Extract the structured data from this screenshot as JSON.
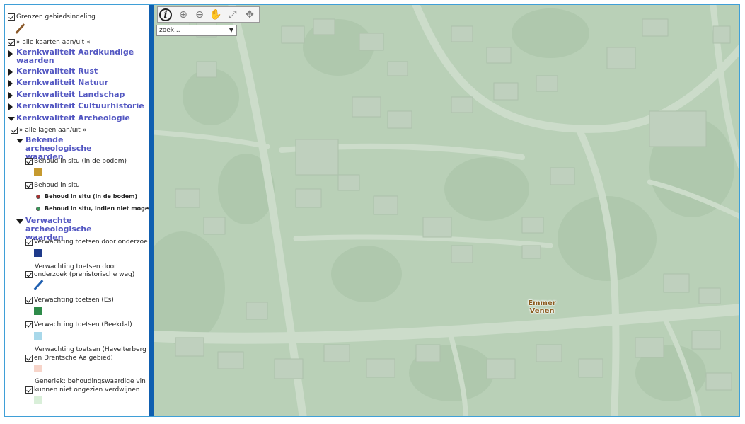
{
  "sidebar": {
    "boundaries_label": "Grenzen gebiedsindeling",
    "all_maps_label": "» alle kaarten aan/uit «",
    "groups": [
      "Kernkwaliteit Aardkundige waarden",
      "Kernkwaliteit Rust",
      "Kernkwaliteit Natuur",
      "Kernkwaliteit Landschap",
      "Kernkwaliteit Cultuurhistorie",
      "Kernkwaliteit Archeologie"
    ],
    "all_layers_label": "» alle lagen aan/uit «",
    "subgroup_known": "Bekende archeologische waarden",
    "subgroup_expected": "Verwachte archeologische waarden",
    "layers": {
      "behoud_situ_bodem": "Behoud in situ (in de bodem)",
      "behoud_situ": "Behoud in situ",
      "legend_red": "Behoud in situ (in de bodem)",
      "legend_green": "Behoud in situ, indien niet mogelijk: I",
      "verw_onderzoek": "Verwachting toetsen door onderzoe",
      "verw_weg_line1": "Verwachting toetsen door",
      "verw_weg_line2": "onderzoek (prehistorische weg)",
      "verw_es": "Verwachting toetsen (Es)",
      "verw_beekdal": "Verwachting toetsen (Beekdal)",
      "verw_havelterberg_line1": "Verwachting toetsen (Havelterberg",
      "verw_havelterberg_line2": "en Drentsche Aa gebied)",
      "generiek_line1": "Generiek: behoudingswaardige vin",
      "generiek_line2": "kunnen niet ongezien verdwijnen"
    }
  },
  "colors": {
    "accent_border": "#3f9fd7",
    "divider": "#0f5fb0",
    "group_text": "#5357c2",
    "swatch_gold": "#c69a2f",
    "swatch_navy": "#1e3a8a",
    "swatch_green": "#2e8b4a",
    "swatch_lightblue": "#a8d8ea",
    "swatch_pink": "#f7d4c9",
    "swatch_palegreen": "#d9efd9",
    "dot_red": "#b03030",
    "dot_green": "#3a9a5a",
    "line_brown": "#8b5a2b",
    "line_blue": "#1f5fb0"
  },
  "map": {
    "search_placeholder": "zoek...",
    "place_label_line1": "Emmer",
    "place_label_line2": "Venen",
    "tools": [
      "info-icon",
      "zoom-in-icon",
      "zoom-out-icon",
      "pan-hand-icon",
      "full-extent-icon",
      "navigate-icon"
    ]
  }
}
